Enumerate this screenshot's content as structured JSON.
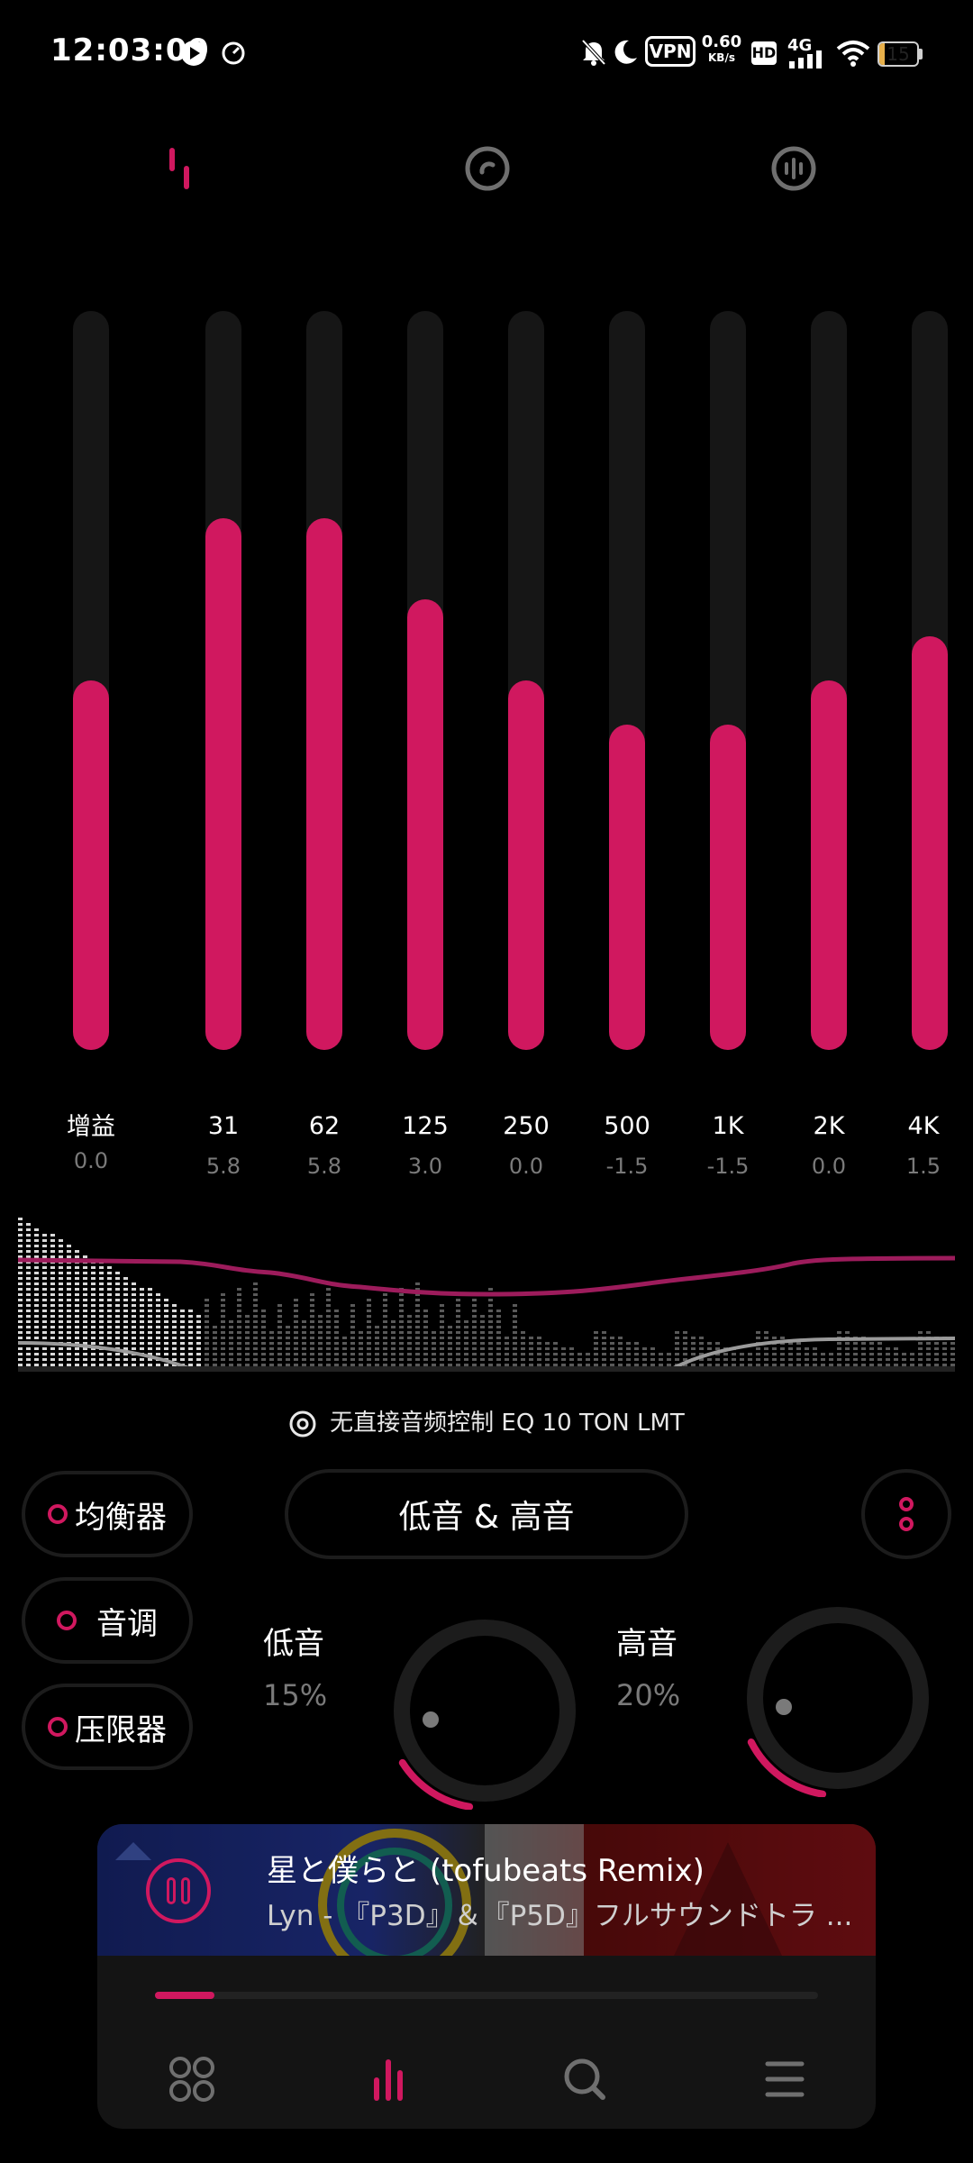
{
  "status_bar": {
    "time": "12:03:09",
    "vpn": "VPN",
    "speed_value": "0.60",
    "speed_unit": "KB/s",
    "hd": "HD",
    "network": "4G",
    "battery": "15",
    "battery_level_percent": 15
  },
  "top_tabs": [
    {
      "icon": "equalizer-tab-icon",
      "active": true
    },
    {
      "icon": "disc-tab-icon",
      "active": false
    },
    {
      "icon": "visualizer-tab-icon",
      "active": false
    }
  ],
  "equalizer": {
    "range_db": [
      -12,
      12
    ],
    "bands": [
      {
        "label": "增益",
        "value": "0.0",
        "level_percent": 50
      },
      {
        "label": "31",
        "value": "5.8",
        "level_percent": 72
      },
      {
        "label": "62",
        "value": "5.8",
        "level_percent": 72
      },
      {
        "label": "125",
        "value": "3.0",
        "level_percent": 61
      },
      {
        "label": "250",
        "value": "0.0",
        "level_percent": 50
      },
      {
        "label": "500",
        "value": "-1.5",
        "level_percent": 44
      },
      {
        "label": "1K",
        "value": "-1.5",
        "level_percent": 44
      },
      {
        "label": "2K",
        "value": "0.0",
        "level_percent": 50
      },
      {
        "label": "4K",
        "value": "1.5",
        "level_percent": 56
      }
    ]
  },
  "eq_status": "无直接音频控制 EQ 10 TON LMT",
  "side_buttons": {
    "equalizer": "均衡器",
    "tone": "音调",
    "limiter": "压限器"
  },
  "mode_button": "低音 & 高音",
  "knobs": {
    "bass": {
      "label": "低音",
      "value": "15%",
      "level_percent": 15
    },
    "treble": {
      "label": "高音",
      "value": "20%",
      "level_percent": 20
    }
  },
  "player": {
    "title": "星と僕らと (tofubeats Remix)",
    "artist": "Lyn - 『P3D』＆『P5D』フルサウンドトラ ...",
    "progress_percent": 9
  },
  "colors": {
    "accent": "#d0185f",
    "track": "#161616",
    "background": "#000000"
  }
}
